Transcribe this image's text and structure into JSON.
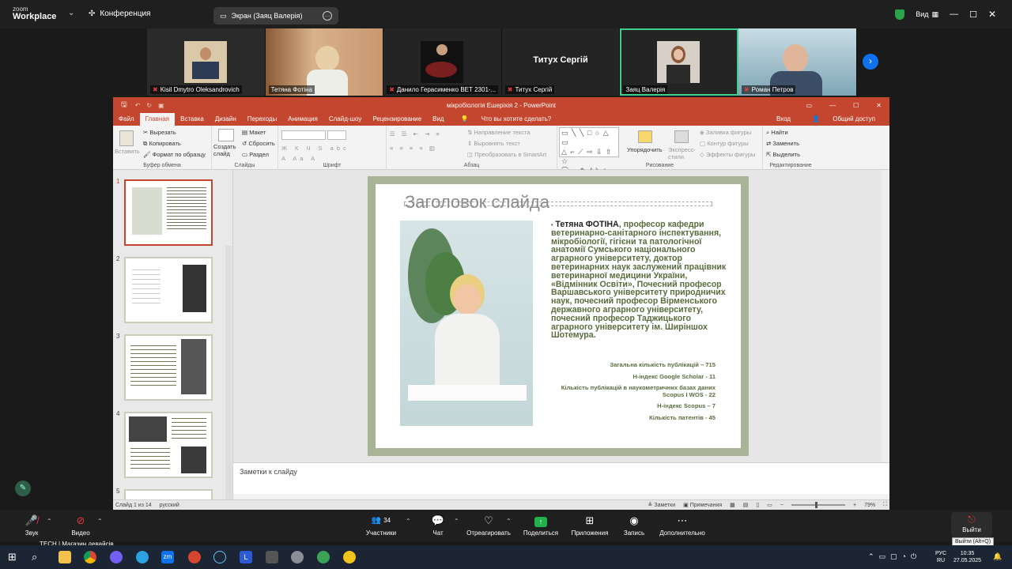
{
  "zoom": {
    "logo_line1": "zoom",
    "logo_line2": "Workplace",
    "conference": "Конференция",
    "share_label": "Экран (Заяц Валерія)",
    "view_label": "Вид"
  },
  "participants": [
    {
      "name": "Kisil Dmytro Oleksandrovich",
      "muted": true
    },
    {
      "name": "Тетяна Фотіна",
      "muted": false
    },
    {
      "name": "Данило Герасименко ВЕТ 2301-...",
      "muted": true
    },
    {
      "name": "Титух Сергій",
      "muted": true,
      "big_label": "Титух Сергій"
    },
    {
      "name": "Заяц Валерія",
      "muted": false
    },
    {
      "name": "Роман Петров",
      "muted": true
    }
  ],
  "ppt": {
    "window_title": "мікробіологія Ешеріхія 2 - PowerPoint",
    "tabs": [
      "Файл",
      "Главная",
      "Вставка",
      "Дизайн",
      "Переходы",
      "Анимация",
      "Слайд-шоу",
      "Рецензирование",
      "Вид"
    ],
    "tell_me": "Что вы хотите сделать?",
    "signin": "Вход",
    "share": "Общий доступ",
    "ribbon": {
      "paste": "Вставить",
      "cut": "Вырезать",
      "copy": "Копировать",
      "format_painter": "Формат по образцу",
      "clipboard": "Буфер обмена",
      "create_slide": "Создать слайд",
      "layout": "Макет",
      "reset": "Сбросить",
      "section": "Раздел",
      "slides": "Слайды",
      "font": "Шрифт",
      "text_dir": "Направление текста",
      "align_text": "Выровнять текст",
      "smartart": "Преобразовать в SmartArt",
      "paragraph": "Абзац",
      "arrange": "Упорядочить",
      "quick_styles": "Экспресс-стили",
      "fill": "Заливка фигуры",
      "outline": "Контур фигуры",
      "effects": "Эффекты фигуры",
      "drawing": "Рисование",
      "find": "Найти",
      "replace": "Заменить",
      "select": "Выделить",
      "editing": "Редактирование"
    },
    "slide": {
      "title": "Заголовок слайда",
      "bio_name": "Тетяна ФОТІНА",
      "bio_rest": ", професор кафедри ветеринарно-санітарного інспектування, мікробіології, гігієни та патологічної анатомії Сумського національного аграрного університету, доктор ветеринарних наук заслужений працівник ветеринарної медицини України, «Відмінник Освіти», Почесний професор Варшавського університету природничих наук, почесний професор Вірменського державного аграрного університету, почесний професор Таджицького аграрного університету ім. Ширіншох Шотемура.",
      "stats": [
        "Загальна кількість публікацій – 715",
        "H-індекс Google Scholar - 11",
        "Кількість публікацій в наукометричних базах даних Scopus I WOS - 22",
        "H-індекс Scopus – 7",
        "Кількість патентів - 45"
      ]
    },
    "thumbs": [
      "1",
      "2",
      "3",
      "4",
      "5"
    ],
    "notes_placeholder": "Заметки к слайду",
    "status_slide": "Слайд 1 из 14",
    "status_lang": "русский",
    "status_notes": "Заметки",
    "status_comments": "Примечания",
    "zoom_level": "79%"
  },
  "bottom": {
    "audio": "Звук",
    "video": "Видео",
    "participants": "Участники",
    "participants_count": "34",
    "chat": "Чат",
    "react": "Отреагировать",
    "share": "Поделиться",
    "apps": "Приложения",
    "record": "Запись",
    "more": "Дополнительно",
    "exit": "Выйти",
    "exit_tip": "Выйти (Alt+Q)"
  },
  "taskbar": {
    "news": "TECH | Магазин девайсів",
    "lang": "РУС",
    "lang2": "RU",
    "time": "10:35",
    "date": "27.05.2025"
  },
  "colors": {
    "ppt_accent": "#c4462e",
    "slide_frame": "#a7b596",
    "zoom_blue": "#0e72ed",
    "share_green": "#22b24c"
  }
}
